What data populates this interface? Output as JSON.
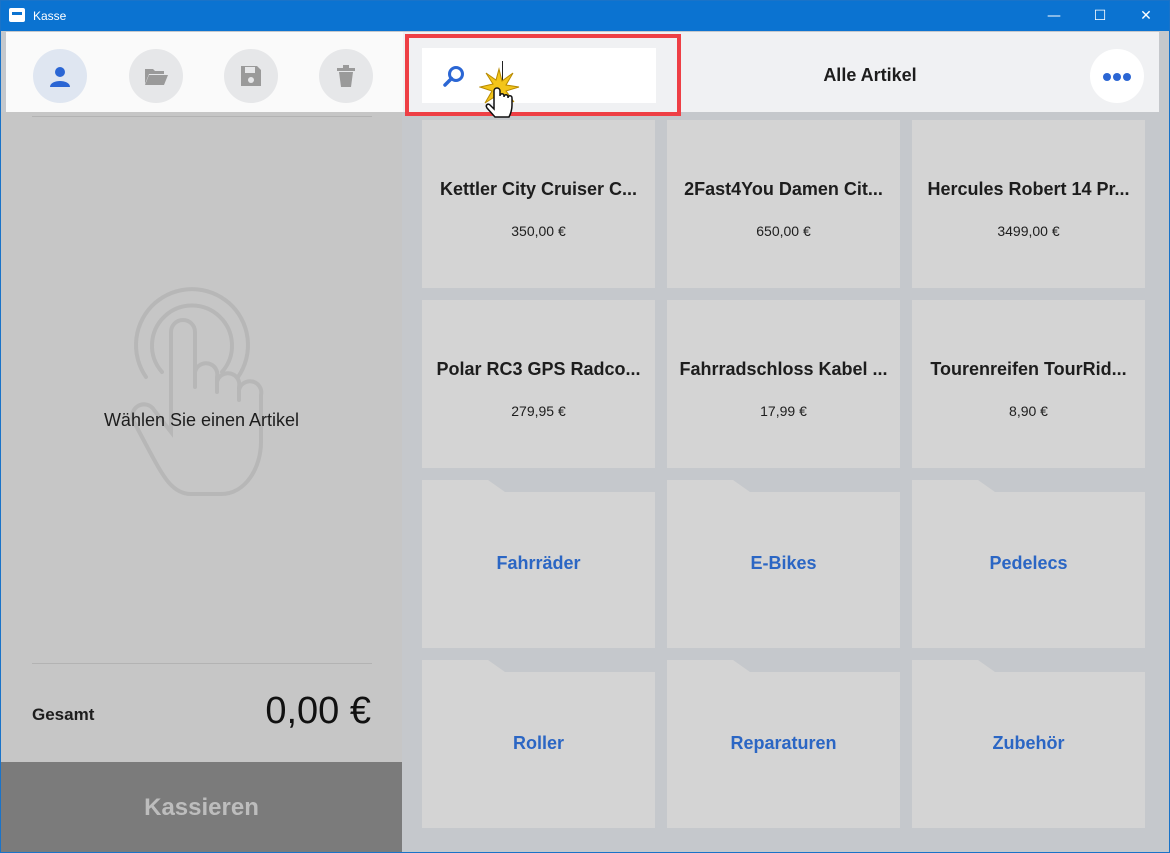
{
  "window": {
    "title": "Kasse",
    "minimize": "—",
    "maximize": "☐",
    "close": "✕"
  },
  "toolbar": {
    "buttons": [
      {
        "name": "customer",
        "icon": "person-icon"
      },
      {
        "name": "open",
        "icon": "folder-open-icon"
      },
      {
        "name": "save",
        "icon": "floppy-icon"
      },
      {
        "name": "delete",
        "icon": "trash-icon"
      }
    ],
    "search": {
      "value": "",
      "placeholder": ""
    },
    "category_title": "Alle Artikel",
    "more_icon": "more-icon"
  },
  "cart": {
    "empty_text": "Wählen Sie einen Artikel",
    "total_label": "Gesamt",
    "total_value": "0,00 €",
    "checkout_label": "Kassieren"
  },
  "articles": [
    {
      "name": "Kettler City Cruiser C...",
      "price": "350,00 €"
    },
    {
      "name": "2Fast4You Damen Cit...",
      "price": "650,00 €"
    },
    {
      "name": "Hercules Robert 14 Pr...",
      "price": "3499,00 €"
    },
    {
      "name": "Polar RC3 GPS Radco...",
      "price": "279,95 €"
    },
    {
      "name": "Fahrradschloss Kabel ...",
      "price": "17,99 €"
    },
    {
      "name": "Tourenreifen TourRid...",
      "price": "8,90 €"
    }
  ],
  "categories": [
    {
      "label": "Fahrräder"
    },
    {
      "label": "E-Bikes"
    },
    {
      "label": "Pedelecs"
    },
    {
      "label": "Roller"
    },
    {
      "label": "Reparaturen"
    },
    {
      "label": "Zubehör"
    }
  ],
  "colors": {
    "accent": "#2b66d4",
    "titlebar": "#0b73d1",
    "highlight": "#ee3f45",
    "checkout_bg": "#7b7b7b"
  }
}
